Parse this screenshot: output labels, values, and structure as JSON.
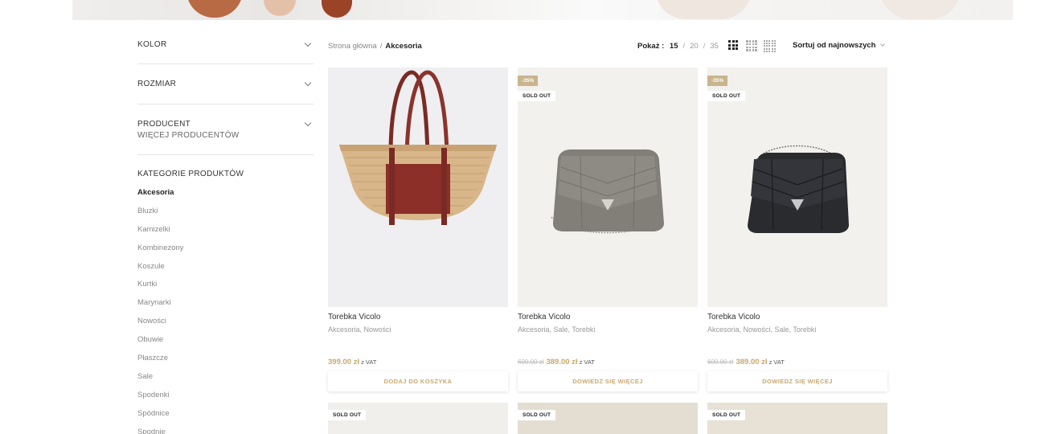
{
  "sidebar": {
    "filters": [
      {
        "title": "KOLOR"
      },
      {
        "title": "ROZMIAR"
      },
      {
        "title": "PRODUCENT",
        "more_link": "WIĘCEJ PRODUCENTÓW"
      }
    ],
    "categories_title": "KATEGORIE PRODUKTÓW",
    "categories": [
      {
        "label": "Akcesoria",
        "active": true
      },
      {
        "label": "Bluzki"
      },
      {
        "label": "Kamizelki"
      },
      {
        "label": "Kombinezony"
      },
      {
        "label": "Koszule"
      },
      {
        "label": "Kurtki"
      },
      {
        "label": "Marynarki"
      },
      {
        "label": "Nowości"
      },
      {
        "label": "Obuwie"
      },
      {
        "label": "Płaszcze"
      },
      {
        "label": "Sale"
      },
      {
        "label": "Spodenki"
      },
      {
        "label": "Spódnice"
      },
      {
        "label": "Spodnie"
      }
    ]
  },
  "toolbar": {
    "breadcrumb": {
      "home": "Strona główna",
      "separator": "/",
      "current": "Akcesoria"
    },
    "per_page": {
      "label": "Pokaż :",
      "options": [
        "15",
        "20",
        "35"
      ],
      "selected": "15",
      "separator": "/"
    },
    "grid_views": [
      "3-columns-icon",
      "4-columns-icon",
      "5-columns-icon"
    ],
    "sort": {
      "selected": "Sortuj od najnowszych"
    }
  },
  "products": [
    {
      "name": "Torebka Vicolo",
      "categories": "Akcesoria, Nowości",
      "price_now": "399.00 zł",
      "vat": "z VAT",
      "cta": "DODAJ DO KOSZYKA",
      "badges": []
    },
    {
      "name": "Torebka Vicolo",
      "categories": "Akcesoria, Sale, Torebki",
      "price_old": "600.00 zł",
      "price_now": "389.00 zł",
      "vat": "z VAT",
      "cta": "DOWIEDZ SIĘ WIĘCEJ",
      "badges": [
        "-35%",
        "SOLD OUT"
      ]
    },
    {
      "name": "Torebka Vicolo",
      "categories": "Akcesoria, Nowości, Sale, Torebki",
      "price_old": "600.00 zł",
      "price_now": "389.00 zł",
      "vat": "z VAT",
      "cta": "DOWIEDZ SIĘ WIĘCEJ",
      "badges": [
        "-35%",
        "SOLD OUT"
      ]
    }
  ],
  "next_row_badges": [
    "SOLD OUT",
    "SOLD OUT",
    "SOLD OUT"
  ],
  "colors": {
    "accent": "#c9a86e",
    "sale_badge": "#c9b48e",
    "text": "#333333",
    "muted": "#999999"
  }
}
